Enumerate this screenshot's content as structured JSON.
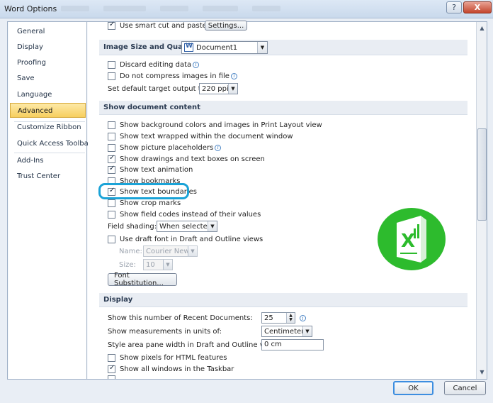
{
  "window": {
    "title": "Word Options",
    "help_label": "?",
    "close_label": "X"
  },
  "nav": {
    "items": [
      {
        "label": "General"
      },
      {
        "label": "Display"
      },
      {
        "label": "Proofing"
      },
      {
        "label": "Save"
      },
      {
        "label": "Language"
      },
      {
        "label": "Advanced",
        "active": true
      },
      {
        "label": "Customize Ribbon"
      },
      {
        "label": "Quick Access Toolbar"
      },
      {
        "label": "Add-Ins"
      },
      {
        "label": "Trust Center"
      }
    ]
  },
  "top": {
    "smart_cut_label": "Use smart cut and paste",
    "settings_button": "Settings..."
  },
  "image_size": {
    "heading": "Image Size and Quality",
    "document_select": "Document1",
    "discard_label": "Discard editing data",
    "no_compress_label": "Do not compress images in file",
    "target_output_label": "Set default target output to:",
    "target_output_value": "220 ppi"
  },
  "show_content": {
    "heading": "Show document content",
    "options": [
      {
        "label": "Show background colors and images in Print Layout view",
        "checked": false
      },
      {
        "label": "Show text wrapped within the document window",
        "checked": false
      },
      {
        "label": "Show picture placeholders",
        "checked": false,
        "info": true
      },
      {
        "label": "Show drawings and text boxes on screen",
        "checked": true
      },
      {
        "label": "Show text animation",
        "checked": true
      },
      {
        "label": "Show bookmarks",
        "checked": false
      },
      {
        "label": "Show text boundaries",
        "checked": true
      },
      {
        "label": "Show crop marks",
        "checked": false
      },
      {
        "label": "Show field codes instead of their values",
        "checked": false
      }
    ],
    "field_shading_label": "Field shading:",
    "field_shading_value": "When selected",
    "draft_font_label": "Use draft font in Draft and Outline views",
    "name_label": "Name:",
    "name_value": "Courier New",
    "size_label": "Size:",
    "size_value": "10",
    "font_sub_button": "Font Substitution..."
  },
  "display": {
    "heading": "Display",
    "recent_docs_label": "Show this number of Recent Documents:",
    "recent_docs_value": "25",
    "units_label": "Show measurements in units of:",
    "units_value": "Centimeters",
    "style_area_label": "Style area pane width in Draft and Outline views:",
    "style_area_value": "0 cm",
    "pixels_label": "Show pixels for HTML features",
    "pixels_checked": false,
    "all_windows_label": "Show all windows in the Taskbar",
    "all_windows_checked": true
  },
  "footer": {
    "ok_label": "OK",
    "cancel_label": "Cancel"
  },
  "colors": {
    "highlight": "#1ba3d7",
    "logo_green": "#2dbb2d",
    "nav_active": "#f7cf5f"
  }
}
